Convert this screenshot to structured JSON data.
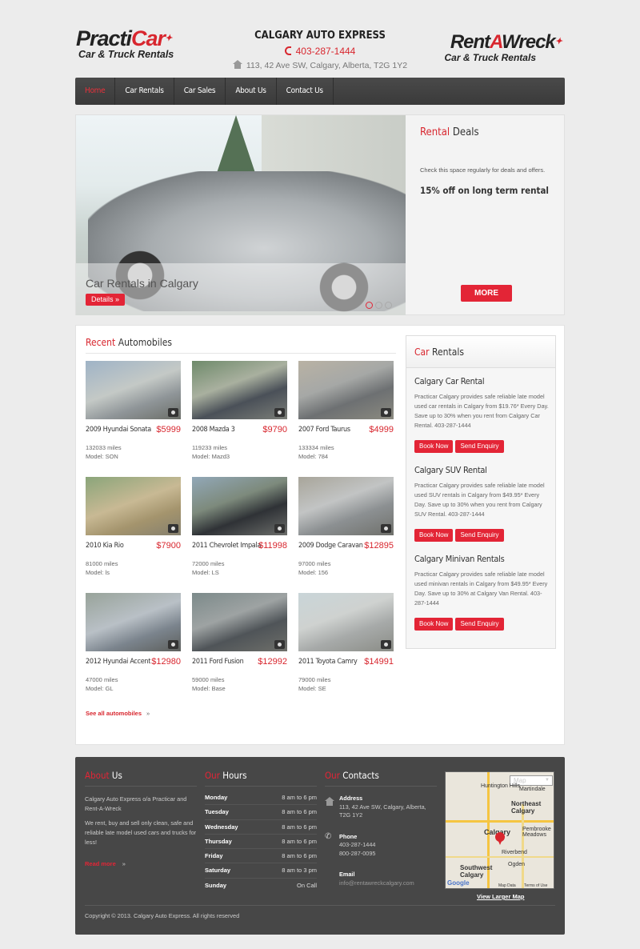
{
  "header": {
    "logo_left": {
      "brand_a": "Practi",
      "brand_b": "Car",
      "sub": "Car & Truck Rentals"
    },
    "company": "CALGARY AUTO EXPRESS",
    "phone": "403-287-1444",
    "address": "113, 42 Ave SW, Calgary, Alberta, T2G 1Y2",
    "logo_right": {
      "brand_a": "Rent",
      "brand_b": "A",
      "brand_c": "Wreck",
      "sub": "Car & Truck Rentals"
    }
  },
  "nav": [
    "Home",
    "Car Rentals",
    "Car Sales",
    "About Us",
    "Contact Us"
  ],
  "hero": {
    "caption": "Car Rentals in Calgary",
    "details": "Details »",
    "deals_title_a": "Rental",
    "deals_title_b": " Deals",
    "deals_text": "Check this space regularly for deals and offers.",
    "deals_offer": "15% off on long term rental",
    "more": "MORE"
  },
  "recent": {
    "title_a": "Recent",
    "title_b": " Automobiles",
    "see_all": "See all automobiles",
    "see_all_chev": "»",
    "items": [
      {
        "title": "2009 Hyundai Sonata",
        "price": "$5999",
        "miles": "132033 miles",
        "model": "Model: SON"
      },
      {
        "title": "2008 Mazda 3",
        "price": "$9790",
        "miles": "119233 miles",
        "model": "Model: Mazd3"
      },
      {
        "title": "2007 Ford Taurus",
        "price": "$4999",
        "miles": "133334 miles",
        "model": "Model: 784"
      },
      {
        "title": "2010 Kia Rio",
        "price": "$7900",
        "miles": "81000 miles",
        "model": "Model: ls"
      },
      {
        "title": "2011 Chevrolet Impala",
        "price": "$11998",
        "miles": "72000 miles",
        "model": "Model: LS"
      },
      {
        "title": "2009 Dodge Caravan",
        "price": "$12895",
        "miles": "97000 miles",
        "model": "Model: 156"
      },
      {
        "title": "2012 Hyundai Accent",
        "price": "$12980",
        "miles": "47000 miles",
        "model": "Model: GL"
      },
      {
        "title": "2011 Ford Fusion",
        "price": "$12992",
        "miles": "59000 miles",
        "model": "Model: Base"
      },
      {
        "title": "2011 Toyota Camry",
        "price": "$14991",
        "miles": "79000 miles",
        "model": "Model: SE"
      }
    ]
  },
  "sidebar": {
    "title_a": "Car",
    "title_b": " Rentals",
    "services": [
      {
        "title": "Calgary Car Rental",
        "text": "Practicar Calgary provides safe reliable late model used car rentals in Calgary from $19.76* Every Day. Save up to 30% when you rent from Calgary Car Rental. 403-287-1444"
      },
      {
        "title": "Calgary SUV Rental",
        "text": "Practicar Calgary provides safe reliable late model used SUV rentals in Calgary from $49.95* Every Day. Save up to 30% when you rent from Calgary SUV Rental. 403-287-1444"
      },
      {
        "title": "Calgary Minivan Rentals",
        "text": "Practicar Calgary provides safe reliable late model used minivan rentals in Calgary from $49.95* Every Day. Save up to 30% at Calgary Van Rental. 403-287-1444"
      }
    ],
    "book_now": "Book Now",
    "send_enquiry": "Send Enquiry"
  },
  "footer": {
    "about_a": "About",
    "about_b": " Us",
    "about_text1": "Calgary Auto Express o/a Practicar and Rent-A-Wreck",
    "about_text2": "We rent, buy and sell only clean, safe and reliable late model used cars and trucks for less!",
    "read_more": "Read more",
    "read_more_chev": "»",
    "hours_a": "Our",
    "hours_b": " Hours",
    "hours": [
      {
        "day": "Monday",
        "time": "8 am to 6 pm"
      },
      {
        "day": "Tuesday",
        "time": "8 am to 6 pm"
      },
      {
        "day": "Wednesday",
        "time": "8 am to 6 pm"
      },
      {
        "day": "Thursday",
        "time": "8 am to 6 pm"
      },
      {
        "day": "Friday",
        "time": "8 am to 6 pm"
      },
      {
        "day": "Saturday",
        "time": "8 am to 3 pm"
      },
      {
        "day": "Sunday",
        "time": "On Call"
      }
    ],
    "contacts_a": "Our",
    "contacts_b": " Contacts",
    "address_label": "Address",
    "address": "113, 42 Ave SW, Calgary, Alberta, T2G 1Y2",
    "phone_label": "Phone",
    "phone1": "403-287-1444",
    "phone2": "800-287-0095",
    "email_label": "Email",
    "email": "info@rentawreckcalgary.com",
    "map": {
      "type_btn": "Map",
      "labels": [
        "Huntington Hills",
        "Martindale",
        "Northeast Calgary",
        "Pembrooke Meadows",
        "Calgary",
        "Riverbend",
        "Ogden",
        "Southwest Calgary",
        "Google",
        "Map Data",
        "Terms of Use"
      ]
    },
    "view_map": "View Larger Map",
    "copyright": "Copyright © 2013. Calgary Auto Express. All rights reserved"
  },
  "colors": {
    "accent": "#d8262e",
    "nav_bg": "#444444",
    "footer_bg": "#474747"
  }
}
